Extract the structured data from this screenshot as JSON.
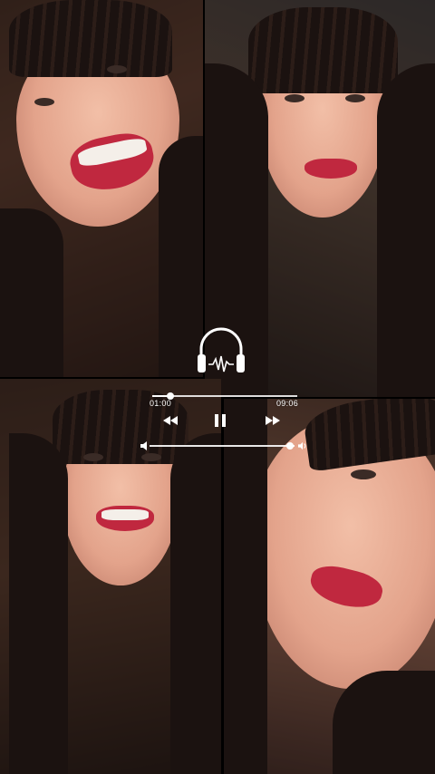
{
  "player": {
    "elapsed": "01:00",
    "total": "09:06",
    "progress": 0.125,
    "volume": 0.97,
    "state": "playing",
    "accent": "#ffffff"
  },
  "icons": {
    "headphones": "headphones-icon",
    "rewind": "rewind-icon",
    "pause": "pause-icon",
    "forward": "forward-icon",
    "volume_low": "volume-low-icon",
    "volume_high": "volume-high-icon"
  }
}
